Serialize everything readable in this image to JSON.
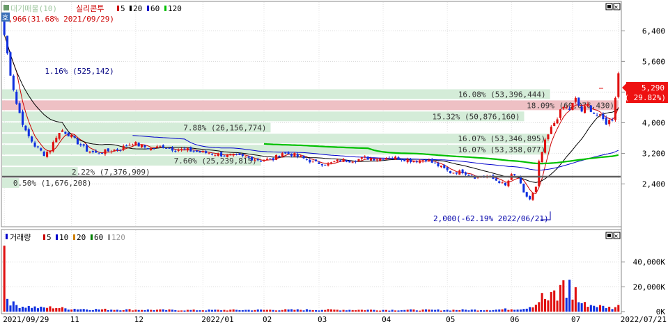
{
  "price_chart": {
    "legend": {
      "main": "대기매물(10)",
      "stock": "실리콘투",
      "ma_items": [
        {
          "label": "5",
          "color": "#cc0000"
        },
        {
          "label": "20",
          "color": "#000000"
        },
        {
          "label": "60",
          "color": "#0000cc"
        },
        {
          "label": "120",
          "color": "#00c000"
        }
      ]
    },
    "high_annotation": "6,966(31.68% 2021/09/29)",
    "low_annotation": "2,000(-62.19% 2022/06/21)",
    "current_price": "5,290",
    "current_change": "( 29.82%)",
    "corner_tag": "호",
    "win_buttons": [
      "▣",
      "×"
    ],
    "y_ticks": [
      {
        "value": 6400,
        "label": "6,400"
      },
      {
        "value": 5600,
        "label": "5,600"
      },
      {
        "value": 4800,
        "label": "4,800"
      },
      {
        "value": 4000,
        "label": "4,000"
      },
      {
        "value": 3200,
        "label": "3,200"
      },
      {
        "value": 2400,
        "label": "2,400"
      }
    ],
    "ylim": [
      1300,
      7150
    ]
  },
  "volume_profile": [
    {
      "label": "16.08% (53,396,444)",
      "pct": 16.08,
      "price_low": 4600,
      "price_high": 4890,
      "color": "#d4ecd8",
      "label_side": "right"
    },
    {
      "label": "18.09% (60,076,430)",
      "pct": 18.09,
      "price_low": 4310,
      "price_high": 4600,
      "color": "#eec0c4",
      "label_side": "right"
    },
    {
      "label": "15.32% (50,876,160)",
      "pct": 15.32,
      "price_low": 4020,
      "price_high": 4310,
      "color": "#d4ecd8",
      "label_side": "right"
    },
    {
      "label": "7.88% (26,156,774)",
      "pct": 7.88,
      "price_low": 3730,
      "price_high": 4020,
      "color": "#d4ecd8",
      "label_side": "right"
    },
    {
      "label": "16.07% (53,346,895)",
      "pct": 16.07,
      "price_low": 3440,
      "price_high": 3730,
      "color": "#d4ecd8",
      "label_side": "right"
    },
    {
      "label": "16.07% (53,358,077)",
      "pct": 16.07,
      "price_low": 3150,
      "price_high": 3440,
      "color": "#d4ecd8",
      "label_side": "right"
    },
    {
      "label": "7.60% (25,239,815)",
      "pct": 7.6,
      "price_low": 2860,
      "price_high": 3150,
      "color": "#d4ecd8",
      "label_side": "right"
    },
    {
      "label": "2.22% (7,376,909)",
      "pct": 2.22,
      "price_low": 2570,
      "price_high": 2860,
      "color": "#d4ecd8",
      "label_side": "right"
    },
    {
      "label": "0.50% (1,676,208)",
      "pct": 0.5,
      "price_low": 2280,
      "price_high": 2570,
      "color": "#d4ecd8",
      "label_side": "right"
    },
    {
      "label": "1.16% (525,142)",
      "pct": 1.16,
      "price_low": 5210,
      "price_high": 5500,
      "color": "#ffffff",
      "label_side": "right"
    }
  ],
  "volume_chart": {
    "legend": {
      "main": "거래량",
      "ma_items": [
        {
          "label": "5",
          "color": "#cc0000"
        },
        {
          "label": "10",
          "color": "#0000cc"
        },
        {
          "label": "20",
          "color": "#d08000"
        },
        {
          "label": "60",
          "color": "#008000"
        },
        {
          "label": "120",
          "color": "#999999"
        }
      ]
    },
    "y_ticks": [
      {
        "value": 40000,
        "label": "40,000K"
      },
      {
        "value": 20000,
        "label": "20,000K"
      },
      {
        "value": 0,
        "label": "0K"
      }
    ],
    "ylim": [
      0,
      55000
    ]
  },
  "x_axis": {
    "labels": [
      {
        "label": "2021/09/29",
        "i": 0
      },
      {
        "label": "11",
        "i": 22
      },
      {
        "label": "12",
        "i": 43
      },
      {
        "label": "2022/01",
        "i": 65
      },
      {
        "label": "02",
        "i": 85
      },
      {
        "label": "03",
        "i": 103
      },
      {
        "label": "04",
        "i": 124
      },
      {
        "label": "05",
        "i": 145
      },
      {
        "label": "06",
        "i": 166
      },
      {
        "label": "07",
        "i": 186
      },
      {
        "label": "2022/07/21",
        "i": 201
      }
    ],
    "n_days": 202
  },
  "chart_data": {
    "type": "candlestick",
    "title": "실리콘투",
    "x_range": [
      "2021/09/29",
      "2022/07/21"
    ],
    "ylim": [
      1300,
      7150
    ],
    "high_point": {
      "value": 6966,
      "date": "2021/09/29"
    },
    "low_point": {
      "value": 2000,
      "date": "2022/06/21"
    },
    "last_close": 5290,
    "change_pct": 29.82,
    "price_anchors": [
      [
        0,
        6300
      ],
      [
        2,
        5300
      ],
      [
        4,
        4500
      ],
      [
        7,
        3750
      ],
      [
        10,
        3400
      ],
      [
        13,
        3180
      ],
      [
        15,
        3300
      ],
      [
        17,
        3650
      ],
      [
        19,
        3800
      ],
      [
        21,
        3700
      ],
      [
        24,
        3480
      ],
      [
        27,
        3280
      ],
      [
        30,
        3200
      ],
      [
        34,
        3260
      ],
      [
        38,
        3320
      ],
      [
        42,
        3480
      ],
      [
        45,
        3380
      ],
      [
        48,
        3320
      ],
      [
        52,
        3380
      ],
      [
        56,
        3300
      ],
      [
        60,
        3280
      ],
      [
        64,
        3230
      ],
      [
        68,
        3200
      ],
      [
        72,
        3150
      ],
      [
        76,
        3130
      ],
      [
        80,
        3080
      ],
      [
        84,
        3020
      ],
      [
        88,
        3050
      ],
      [
        91,
        3220
      ],
      [
        94,
        3180
      ],
      [
        98,
        3060
      ],
      [
        102,
        2950
      ],
      [
        106,
        2920
      ],
      [
        110,
        3020
      ],
      [
        114,
        3010
      ],
      [
        118,
        3080
      ],
      [
        122,
        3060
      ],
      [
        126,
        3100
      ],
      [
        130,
        3060
      ],
      [
        134,
        3000
      ],
      [
        138,
        3040
      ],
      [
        142,
        2880
      ],
      [
        146,
        2700
      ],
      [
        150,
        2720
      ],
      [
        154,
        2580
      ],
      [
        158,
        2600
      ],
      [
        162,
        2460
      ],
      [
        164,
        2350
      ],
      [
        166,
        2620
      ],
      [
        168,
        2600
      ],
      [
        170,
        2150
      ],
      [
        172,
        2000
      ],
      [
        174,
        2300
      ],
      [
        175,
        2950
      ],
      [
        177,
        3500
      ],
      [
        179,
        3850
      ],
      [
        181,
        4150
      ],
      [
        183,
        4400
      ],
      [
        185,
        4350
      ],
      [
        187,
        4600
      ],
      [
        189,
        4300
      ],
      [
        191,
        4450
      ],
      [
        193,
        4250
      ],
      [
        195,
        4150
      ],
      [
        197,
        4000
      ],
      [
        199,
        4100
      ],
      [
        201,
        5290
      ]
    ],
    "ma_series": [
      {
        "period": 5,
        "color": "#cc0000"
      },
      {
        "period": 20,
        "color": "#000000"
      },
      {
        "period": 60,
        "color": "#0000cc"
      },
      {
        "period": 120,
        "color": "#00c000"
      }
    ],
    "volume_anchors": [
      [
        0,
        52000
      ],
      [
        1,
        12000
      ],
      [
        2,
        8000
      ],
      [
        3,
        6000
      ],
      [
        5,
        4500
      ],
      [
        8,
        4000
      ],
      [
        12,
        3000
      ],
      [
        16,
        3500
      ],
      [
        20,
        2500
      ],
      [
        30,
        1800
      ],
      [
        60,
        1200
      ],
      [
        100,
        1500
      ],
      [
        140,
        1300
      ],
      [
        160,
        1500
      ],
      [
        170,
        2500
      ],
      [
        174,
        6000
      ],
      [
        176,
        12000
      ],
      [
        178,
        9000
      ],
      [
        180,
        15000
      ],
      [
        181,
        10000
      ],
      [
        182,
        18000
      ],
      [
        183,
        26000
      ],
      [
        184,
        14000
      ],
      [
        185,
        21000
      ],
      [
        186,
        12000
      ],
      [
        187,
        18000
      ],
      [
        188,
        8000
      ],
      [
        190,
        6000
      ],
      [
        193,
        5000
      ],
      [
        196,
        4000
      ],
      [
        199,
        3000
      ],
      [
        201,
        4500
      ]
    ]
  }
}
